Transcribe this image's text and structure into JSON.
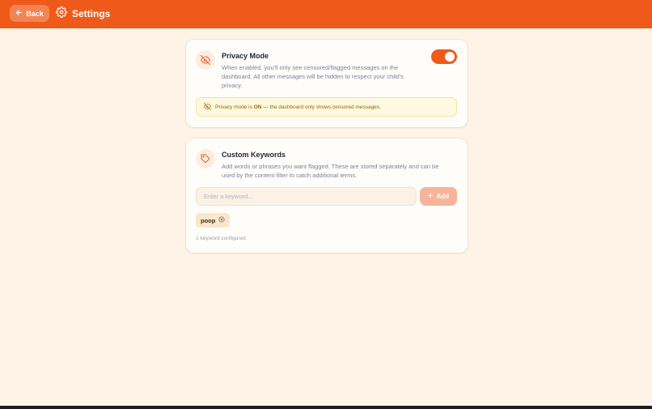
{
  "header": {
    "back_label": "Back",
    "title": "Settings",
    "background_color": "#ef5a1a"
  },
  "privacy": {
    "title": "Privacy Mode",
    "description": "When enabled, you'll only see censored/flagged messages on the dashboard. All other messages will be hidden to respect your child's privacy.",
    "desc_lines": [
      "When enabled, you'll only see censored/flagged messages on the",
      "dashboard. All other messages will be hidden to respect your child's",
      "privacy."
    ],
    "toggle_on": true,
    "icon": "eye-off-icon",
    "notice": {
      "prefix": "Privacy mode is ",
      "state": "ON",
      "suffix": " — the dashboard only shows censored messages."
    }
  },
  "keywords": {
    "title": "Custom Keywords",
    "desc_lines": [
      "Add words or phrases you want flagged. These are stored separately and can be",
      "used by the content filter to catch additional terms."
    ],
    "icon": "tag-icon",
    "input_placeholder": "Enter a keyword...",
    "input_value": "",
    "add_label": "Add",
    "items": [
      "poop"
    ],
    "count_text": "1 keyword configured"
  },
  "colors": {
    "accent": "#ef5a1a",
    "page_background": "#fdf4e7",
    "notice_background": "#fff9df",
    "add_button": "#f6b59a"
  }
}
